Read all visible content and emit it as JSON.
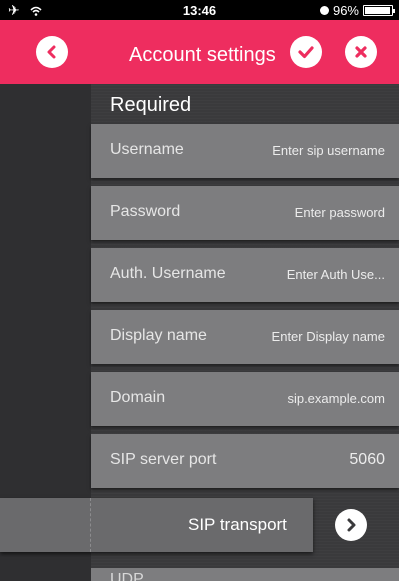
{
  "status_bar": {
    "time": "13:46",
    "battery_text": "96%",
    "battery_level_percent": 96
  },
  "navbar": {
    "title": "Account settings",
    "color": "#ee2d5f"
  },
  "section": {
    "title": "Required"
  },
  "fields": [
    {
      "label": "Username",
      "value": "Enter sip username"
    },
    {
      "label": "Password",
      "value": "Enter password"
    },
    {
      "label": "Auth. Username",
      "value": "Enter Auth Use..."
    },
    {
      "label": "Display name",
      "value": "Enter Display name"
    },
    {
      "label": "Domain",
      "value": "sip.example.com"
    },
    {
      "label": "SIP server port",
      "value": "5060"
    }
  ],
  "transport": {
    "label": "SIP transport",
    "value": "UDP"
  }
}
